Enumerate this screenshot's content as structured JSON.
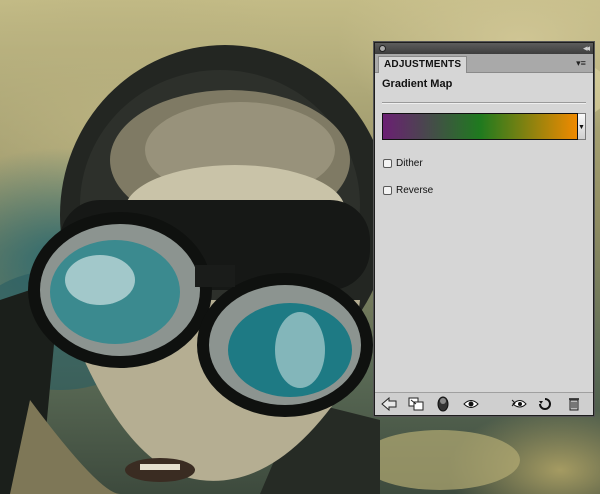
{
  "panel": {
    "tab_label": "ADJUSTMENTS",
    "title": "Gradient Map",
    "gradient": {
      "colors": [
        "#6b1f73",
        "#1f7a1f",
        "#f08a00"
      ]
    },
    "options": [
      {
        "label": "Dither",
        "checked": false
      },
      {
        "label": "Reverse",
        "checked": false
      }
    ],
    "toolbar_icons": [
      "back-arrow-icon",
      "toggle-panel-size-icon",
      "clip-to-layer-icon",
      "visibility-eye-icon",
      "view-previous-state-icon",
      "reset-icon",
      "trash-icon"
    ]
  }
}
